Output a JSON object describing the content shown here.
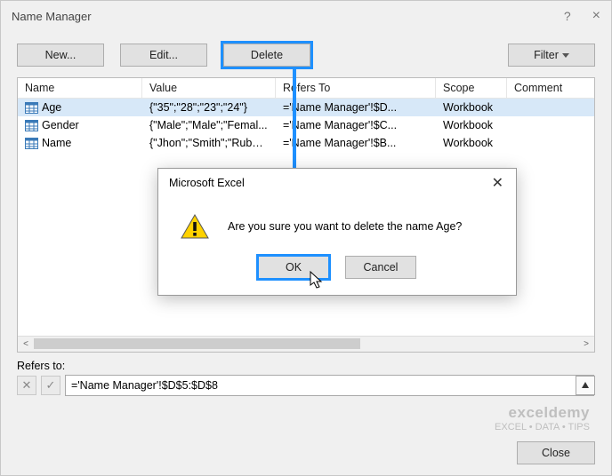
{
  "title": "Name Manager",
  "toolbar": {
    "new": "New...",
    "edit": "Edit...",
    "delete": "Delete",
    "filter": "Filter"
  },
  "columns": {
    "name": "Name",
    "value": "Value",
    "refers": "Refers To",
    "scope": "Scope",
    "comment": "Comment"
  },
  "rows": [
    {
      "name": "Age",
      "value": "{\"35\";\"28\";\"23\";\"24\"}",
      "refers": "='Name Manager'!$D...",
      "scope": "Workbook"
    },
    {
      "name": "Gender",
      "value": "{\"Male\";\"Male\";\"Femal...",
      "refers": "='Name Manager'!$C...",
      "scope": "Workbook"
    },
    {
      "name": "Name",
      "value": "{\"Jhon\";\"Smith\";\"Ruby\"...",
      "refers": "='Name Manager'!$B...",
      "scope": "Workbook"
    }
  ],
  "refers_label": "Refers to:",
  "refers_value": "='Name Manager'!$D$5:$D$8",
  "footer": {
    "close": "Close"
  },
  "modal": {
    "title": "Microsoft Excel",
    "message": "Are you sure you want to delete the name Age?",
    "ok": "OK",
    "cancel": "Cancel"
  },
  "watermark": {
    "brand": "exceldemy",
    "tag": "EXCEL • DATA • TIPS"
  }
}
